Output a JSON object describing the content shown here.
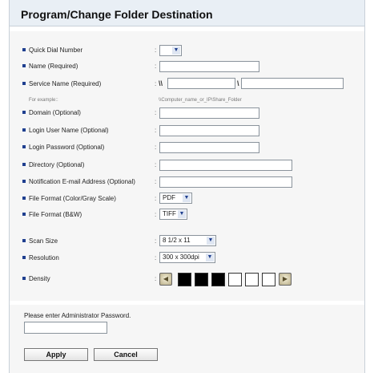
{
  "page": {
    "title": "Program/Change Folder Destination"
  },
  "fields": {
    "quick_dial": {
      "label": "Quick Dial Number",
      "value": ""
    },
    "name": {
      "label": "Name (Required)",
      "value": ""
    },
    "service": {
      "label": "Service Name (Required)",
      "prefix": "\\\\",
      "sep": "\\",
      "value1": "",
      "value2": "",
      "example_label": "For example::",
      "example_value": "\\\\Computer_name_or_IP\\Share_Folder"
    },
    "domain": {
      "label": "Domain (Optional)",
      "value": ""
    },
    "login_user": {
      "label": "Login User Name (Optional)",
      "value": ""
    },
    "login_pw": {
      "label": "Login Password (Optional)",
      "value": ""
    },
    "directory": {
      "label": "Directory (Optional)",
      "value": ""
    },
    "notification": {
      "label": "Notification E-mail Address (Optional)",
      "value": ""
    },
    "format_color": {
      "label": "File Format (Color/Gray Scale)",
      "value": "PDF"
    },
    "format_bw": {
      "label": "File Format (B&W)",
      "value": "TIFF"
    },
    "scan_size": {
      "label": "Scan Size",
      "value": "8 1/2 x 11"
    },
    "resolution": {
      "label": "Resolution",
      "value": "300 x 300dpi"
    },
    "density": {
      "label": "Density",
      "level": 3,
      "max": 7
    }
  },
  "colon": ":",
  "admin": {
    "label": "Please enter Administrator Password.",
    "value": ""
  },
  "buttons": {
    "apply": "Apply",
    "cancel": "Cancel"
  },
  "icons": {
    "dropdown": "chevron-down-icon",
    "density_lighter": "arrow-left-icon",
    "density_darker": "arrow-right-icon"
  },
  "colors": {
    "bullet": "#1f3f8f",
    "header_bg": "#e9eff5",
    "form_bg": "#f6f6f6"
  }
}
